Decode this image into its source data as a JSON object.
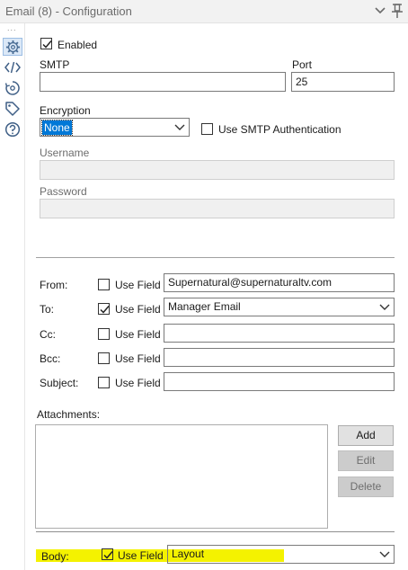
{
  "window": {
    "title": "Email (8) - Configuration"
  },
  "rail": {
    "dots": "..."
  },
  "config": {
    "enabled_label": "Enabled",
    "enabled_checked": true,
    "smtp_label": "SMTP",
    "smtp_value": "",
    "port_label": "Port",
    "port_value": "25",
    "encryption_label": "Encryption",
    "encryption_value": "None",
    "use_smtp_auth_label": "Use SMTP Authentication",
    "use_smtp_auth_checked": false,
    "username_label": "Username",
    "username_value": "",
    "password_label": "Password",
    "password_value": ""
  },
  "fields": {
    "use_field_label": "Use Field",
    "from": {
      "label": "From:",
      "use_field": false,
      "value": "Supernatural@supernaturaltv.com"
    },
    "to": {
      "label": "To:",
      "use_field": true,
      "value": "Manager Email"
    },
    "cc": {
      "label": "Cc:",
      "use_field": false,
      "value": ""
    },
    "bcc": {
      "label": "Bcc:",
      "use_field": false,
      "value": ""
    },
    "subject": {
      "label": "Subject:",
      "use_field": false,
      "value": ""
    }
  },
  "attachments": {
    "label": "Attachments:",
    "add_label": "Add",
    "edit_label": "Edit",
    "delete_label": "Delete"
  },
  "body": {
    "label": "Body:",
    "use_field": true,
    "use_field_label": "Use Field",
    "value": "Layout"
  },
  "colors": {
    "highlight": "#f4f200",
    "selection": "#0078d7",
    "accent": "#9cbde3"
  }
}
